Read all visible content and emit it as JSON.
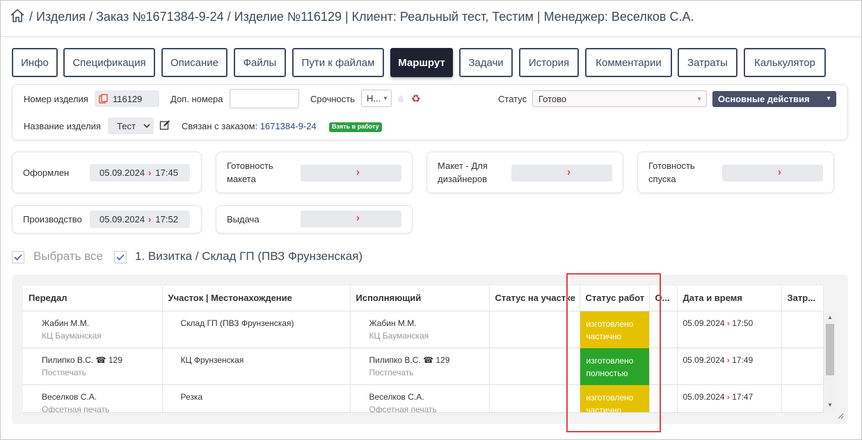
{
  "breadcrumb": "/ Изделия / Заказ №1671384-9-24 / Изделие №116129 | Клиент: Реальный тест, Тестим | Менеджер: Веселков С.А.",
  "tabs": [
    "Инфо",
    "Спецификация",
    "Описание",
    "Файлы",
    "Пути к файлам",
    "Маршрут",
    "Задачи",
    "История",
    "Комментарии",
    "Затраты",
    "Калькулятор"
  ],
  "active_tab": "Маршрут",
  "info": {
    "item_number_label": "Номер изделия",
    "item_number": "116129",
    "extra_numbers_label": "Доп. номера",
    "extra_numbers_value": "",
    "urgency_label": "Срочность",
    "urgency_value": "Н...",
    "status_label": "Статус",
    "status_value": "Готово",
    "main_actions": "Основные действия",
    "name_label": "Название изделия",
    "name_value": "Тест",
    "linked_label": "Связан с заказом:",
    "linked_order": "1671384-9-24",
    "take_badge": "Взять в работу"
  },
  "stages": {
    "registered": {
      "label": "Оформлен",
      "date": "05.09.2024",
      "time": "17:45"
    },
    "layout_ready": {
      "label": "Готовность макета"
    },
    "layout_designers": {
      "label": "Макет - Для дизайнеров"
    },
    "run_ready": {
      "label": "Готовность спуска"
    },
    "production": {
      "label": "Производство",
      "date": "05.09.2024",
      "time": "17:52"
    },
    "issue": {
      "label": "Выдача"
    }
  },
  "select_all": "Выбрать все",
  "group_label": "1. Визитка / Склад ГП (ПВЗ Фрунзенская)",
  "table": {
    "columns": [
      "Передал",
      "Участок | Местонахождение",
      "Исполняющий",
      "Статус на участке",
      "Статус работ",
      "О...",
      "Дата и время",
      "Затр..."
    ],
    "rows": [
      {
        "from_name": "Жабин М.М.",
        "from_sub": "КЦ Бауманская",
        "area": "Склад ГП (ПВЗ Фрунзенская)",
        "exec_name": "Жабин М.М.",
        "exec_sub": "КЦ Бауманская",
        "work_status_1": "изготовлено",
        "work_status_2": "частично",
        "date": "05.09.2024",
        "time": "17:50"
      },
      {
        "from_name": "Пилипко В.С. ☎ 129",
        "from_sub": "Постпечать",
        "area": "КЦ Фрунзенская",
        "exec_name": "Пилипко В.С. ☎ 129",
        "exec_sub": "Постпечать",
        "work_status_1": "изготовлено",
        "work_status_2": "полностью",
        "date": "05.09.2024",
        "time": "17:49"
      },
      {
        "from_name": "Веселков С.А.",
        "from_sub": "Офсетная печать",
        "area": "Резка",
        "exec_name": "Веселков С.А.",
        "exec_sub": "Офсетная печать",
        "work_status_1": "изготовлено",
        "work_status_2": "частично",
        "date": "05.09.2024",
        "time": "17:47"
      }
    ]
  },
  "colors": {
    "partial": "#e5c200",
    "full": "#2aa52a",
    "highlight": "#e04444",
    "badge": "#2e9e44"
  }
}
